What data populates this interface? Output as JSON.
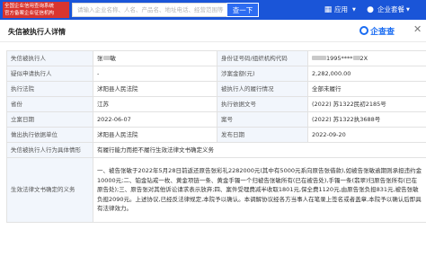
{
  "header": {
    "brand_lines": [
      "全国企业信用查询系统",
      "官方备案企业征信机构"
    ],
    "search_placeholder": "请输入企业名称、人名、产品名、地址电话、经营范围等",
    "search_button": "查一下",
    "app_label": "应用",
    "enterprise_label": "企业套餐"
  },
  "modal": {
    "title": "失信被执行人详情",
    "logo_text": "企查查",
    "close_symbol": "✕"
  },
  "table": {
    "row1": {
      "k1": "失信被执行人",
      "v1_prefix": "张",
      "v1_suffix": "敏",
      "k2": "身份证号码/组织机构代码",
      "v2": "1995****",
      "v2_suffix": "2X"
    },
    "row2": {
      "k1": "疑似申请执行人",
      "v1": "-",
      "k2": "涉案金额(元)",
      "v2": "2,282,000.00"
    },
    "row3": {
      "k1": "执行法院",
      "v1": "沭阳县人民法院",
      "k2": "被执行人的履行情况",
      "v2": "全部未履行"
    },
    "row4": {
      "k1": "省份",
      "v1": "江苏",
      "k2": "执行依据文号",
      "v2": "(2022) 苏1322民初2185号"
    },
    "row5": {
      "k1": "立案日期",
      "v1": "2022-06-07",
      "k2": "案号",
      "v2": "(2022) 苏1322执3688号"
    },
    "row6": {
      "k1": "做出执行依据单位",
      "v1": "沭阳县人民法院",
      "k2": "发布日期",
      "v2": "2022-09-20"
    },
    "row7": {
      "k1": "失信被执行人行为具体情形",
      "v1": "有履行能力而拒不履行生效法律文书确定义务"
    },
    "row8": {
      "k1": "生效法律文书确定的义务",
      "v1": "一、被告张敏于2022年5月28日前返还原告张彩礼2282000元(其中有5000元系向原告张借款),如被告张敏逾期则承担违约金10000元;二、铂金钻戒一枚、黄金项链一条、黄金手镯一个归被告张敏所有(已在被告处),手镯一条(翡翠)归原告张所有(已在原告处);三、原告张对其他诉讼请求表示放弃;四、案件受理费减半收取1801元,保全费1120元,由原告张负担831元,被告张敏负担2090元。上述协议,已经反法律规定,本院予以确认。本调解协议经各方当事人在笔录上签名或者盖章,本院予以确认后即具有法律效力。"
    }
  }
}
